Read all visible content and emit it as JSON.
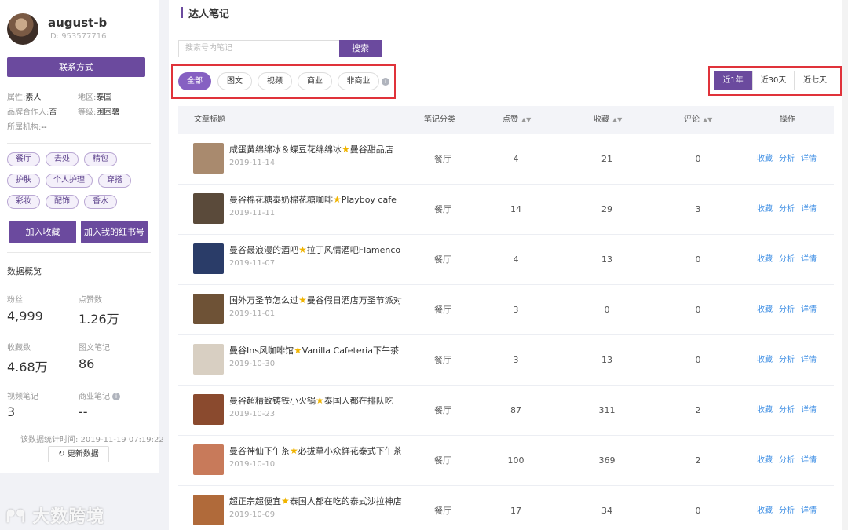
{
  "profile": {
    "name": "august-b",
    "id": "ID: 953577716",
    "contact_btn": "联系方式",
    "attrs": [
      {
        "label": "属性:",
        "value": "素人"
      },
      {
        "label": "地区:",
        "value": "泰国"
      },
      {
        "label": "品牌合作人:",
        "value": "否"
      },
      {
        "label": "等级:",
        "value": "困困薯"
      },
      {
        "label": "所属机构:",
        "value": "--"
      }
    ],
    "tags": [
      "餐厅",
      "去处",
      "精包",
      "护肤",
      "个人护理",
      "穿搭",
      "彩妆",
      "配饰",
      "香水"
    ],
    "add_fav_btn": "加入收藏",
    "add_book_btn": "加入我的红书号"
  },
  "overview": {
    "title": "数据概览",
    "stats": [
      {
        "label": "粉丝",
        "value": "4,999"
      },
      {
        "label": "点赞数",
        "value": "1.26万"
      },
      {
        "label": "收藏数",
        "value": "4.68万"
      },
      {
        "label": "图文笔记",
        "value": "86"
      },
      {
        "label": "视频笔记",
        "value": "3"
      },
      {
        "label": "商业笔记",
        "value": "--"
      }
    ],
    "update_time": "该数据统计时间: 2019-11-19 07:19:22",
    "refresh_btn": "更新数据"
  },
  "watermark": "大数跨境",
  "main": {
    "title": "达人笔记",
    "search_placeholder": "搜索号内笔记",
    "search_btn": "搜索",
    "filters": [
      "全部",
      "图文",
      "视频",
      "商业",
      "非商业"
    ],
    "active_filter": "全部",
    "time_ranges": [
      "近1年",
      "近30天",
      "近七天"
    ],
    "active_time": "近1年"
  },
  "table": {
    "headers": {
      "title": "文章标题",
      "category": "笔记分类",
      "likes": "点赞",
      "favs": "收藏",
      "comments": "评论",
      "ops": "操作"
    },
    "op_labels": [
      "收藏",
      "分析",
      "详情"
    ],
    "rows": [
      {
        "title_a": "咸蛋黄绵绵冰＆蝶豆花绵绵冰",
        "title_b": "曼谷甜品店",
        "date": "2019-11-14",
        "category": "餐厅",
        "likes": "4",
        "favs": "21",
        "comments": "0",
        "thumb": "#a98a6e"
      },
      {
        "title_a": "曼谷棉花糖泰奶棉花糖咖啡",
        "title_b": "Playboy cafe",
        "date": "2019-11-11",
        "category": "餐厅",
        "likes": "14",
        "favs": "29",
        "comments": "3",
        "thumb": "#5a4a3a"
      },
      {
        "title_a": "曼谷最浪漫的酒吧",
        "title_b": "拉丁风情酒吧Flamenco",
        "date": "2019-11-07",
        "category": "餐厅",
        "likes": "4",
        "favs": "13",
        "comments": "0",
        "thumb": "#2a3c68"
      },
      {
        "title_a": "国外万圣节怎么过",
        "title_b": "曼谷假日酒店万圣节派对",
        "date": "2019-11-01",
        "category": "餐厅",
        "likes": "3",
        "favs": "0",
        "comments": "0",
        "thumb": "#6e5236"
      },
      {
        "title_a": "曼谷Ins风咖啡馆",
        "title_b": "Vanilla Cafeteria下午茶",
        "date": "2019-10-30",
        "category": "餐厅",
        "likes": "3",
        "favs": "13",
        "comments": "0",
        "thumb": "#d8cfc2"
      },
      {
        "title_a": "曼谷超精致铸铁小火锅",
        "title_b": "泰国人都在排队吃",
        "date": "2019-10-23",
        "category": "餐厅",
        "likes": "87",
        "favs": "311",
        "comments": "2",
        "thumb": "#8a4a2e"
      },
      {
        "title_a": "曼谷神仙下午茶",
        "title_b": "必拔草小众鲜花泰式下午茶",
        "date": "2019-10-10",
        "category": "餐厅",
        "likes": "100",
        "favs": "369",
        "comments": "2",
        "thumb": "#c87a5a"
      },
      {
        "title_a": "超正宗超便宜",
        "title_b": "泰国人都在吃的泰式沙拉神店",
        "date": "2019-10-09",
        "category": "餐厅",
        "likes": "17",
        "favs": "34",
        "comments": "0",
        "thumb": "#b06a3a"
      }
    ]
  },
  "colors": {
    "brand": "#6b4a9e",
    "highlight": "#e0323a",
    "link": "#3d8ee4"
  }
}
